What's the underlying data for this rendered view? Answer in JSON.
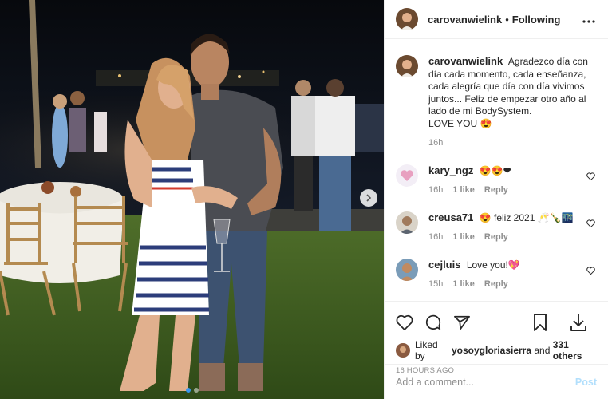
{
  "header": {
    "username": "carovanwielink",
    "separator": "•",
    "follow_status": "Following"
  },
  "caption": {
    "username": "carovanwielink",
    "text": "Agradezco día con día cada momento, cada enseñanza, cada alegría que día con día vivimos juntos... Feliz de empezar otro año al lado de mi BodySystem.\nLOVE YOU 😍",
    "time": "16h"
  },
  "comments": [
    {
      "username": "kary_ngz",
      "text": "😍😍❤",
      "time": "16h",
      "likes": "1 like",
      "reply": "Reply"
    },
    {
      "username": "creusa71",
      "text": "😍 feliz 2021 🥂🍾🌃",
      "time": "16h",
      "likes": "1 like",
      "reply": "Reply"
    },
    {
      "username": "cejluis",
      "text": "Love you!💖",
      "time": "15h",
      "likes": "1 like",
      "reply": "Reply"
    }
  ],
  "likes": {
    "prefix": "Liked by",
    "user": "yosoygloriasierra",
    "and": "and",
    "others": "331 others"
  },
  "time_ago": "16 HOURS AGO",
  "add_comment": {
    "placeholder": "Add a comment...",
    "post_label": "Post"
  },
  "colors": {
    "link_blue": "#3897f0",
    "post_disabled": "#b2dffc",
    "meta_gray": "#8e8e8e"
  }
}
